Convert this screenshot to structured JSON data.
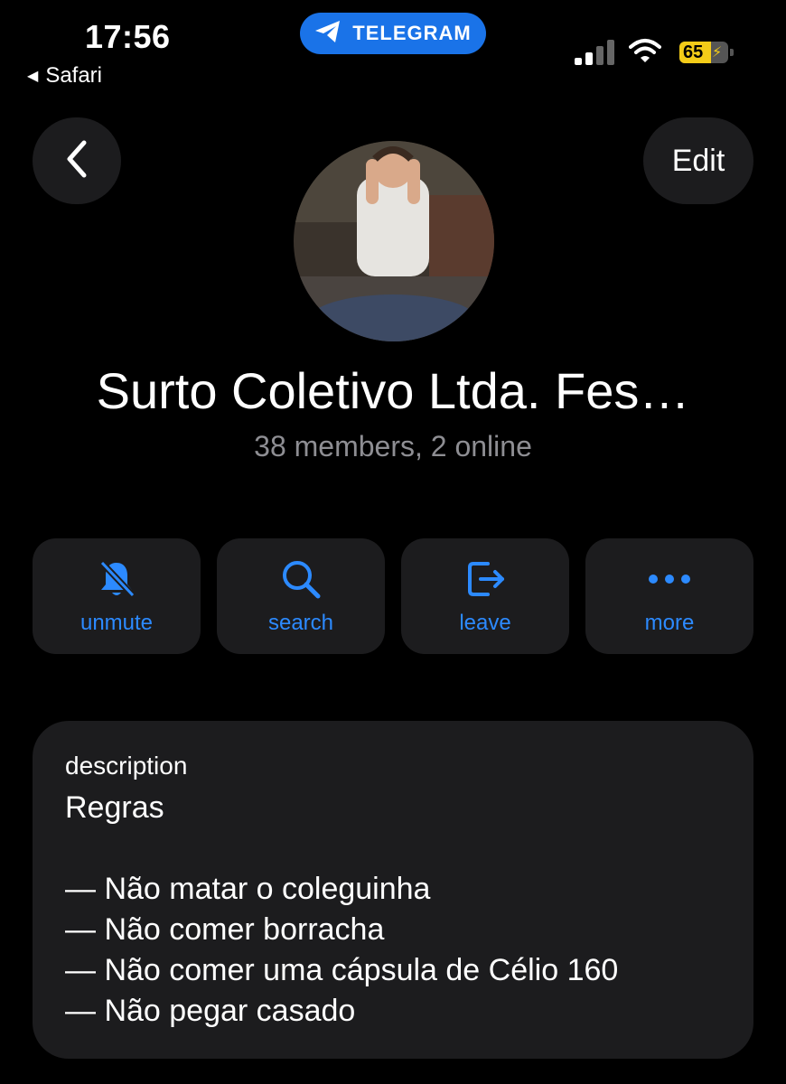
{
  "status": {
    "time": "17:56",
    "back_app": "Safari",
    "pill_label": "TELEGRAM",
    "battery": "65",
    "battery_color": "#f4cc18"
  },
  "nav": {
    "edit_label": "Edit"
  },
  "group": {
    "title": "Surto Coletivo Ltda. Fes…",
    "subtitle": "38 members, 2 online"
  },
  "actions": [
    {
      "label": "unmute",
      "icon": "bell-slash-icon"
    },
    {
      "label": "search",
      "icon": "search-icon"
    },
    {
      "label": "leave",
      "icon": "leave-icon"
    },
    {
      "label": "more",
      "icon": "more-icon"
    }
  ],
  "description": {
    "label": "description",
    "lines": [
      "Regras",
      "",
      "— Não matar o coleguinha",
      "— Não comer borracha",
      "— Não comer uma cápsula de Célio 160",
      "— Não pegar casado"
    ]
  },
  "colors": {
    "accent": "#2c8aff",
    "telegram_pill": "#1a73e8",
    "card": "#1c1c1e",
    "muted_text": "#8e8e93"
  }
}
